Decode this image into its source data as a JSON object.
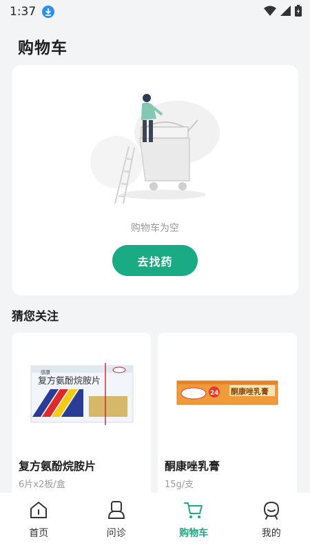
{
  "status_bar": {
    "time": "1:37",
    "icons": [
      "download-icon",
      "wifi-icon",
      "signal-icon",
      "battery-icon"
    ]
  },
  "page": {
    "title": "购物车"
  },
  "empty_cart": {
    "message": "购物车为空",
    "button_label": "去找药",
    "illustration": "empty-shopping-cart-illustration"
  },
  "recommend": {
    "title": "猜您关注",
    "products": [
      {
        "name": "复方氨酚烷胺片",
        "spec": "6片x2板/盒",
        "package_text": "复方氨酚烷胺片",
        "brand": "感康",
        "image": "medicine-box-image"
      },
      {
        "name": "酮康唑乳膏",
        "spec": "15g/支",
        "package_text": "酮康唑乳膏",
        "badge": "24",
        "image": "ointment-box-image"
      }
    ]
  },
  "tabs": [
    {
      "label": "首页",
      "icon": "home-icon",
      "active": false
    },
    {
      "label": "问诊",
      "icon": "consult-icon",
      "active": false
    },
    {
      "label": "购物车",
      "icon": "cart-icon",
      "active": true
    },
    {
      "label": "我的",
      "icon": "profile-icon",
      "active": false
    }
  ],
  "colors": {
    "accent": "#1aab84",
    "background": "#f3f4f6",
    "card": "#ffffff",
    "muted_text": "#9a9a9a"
  }
}
